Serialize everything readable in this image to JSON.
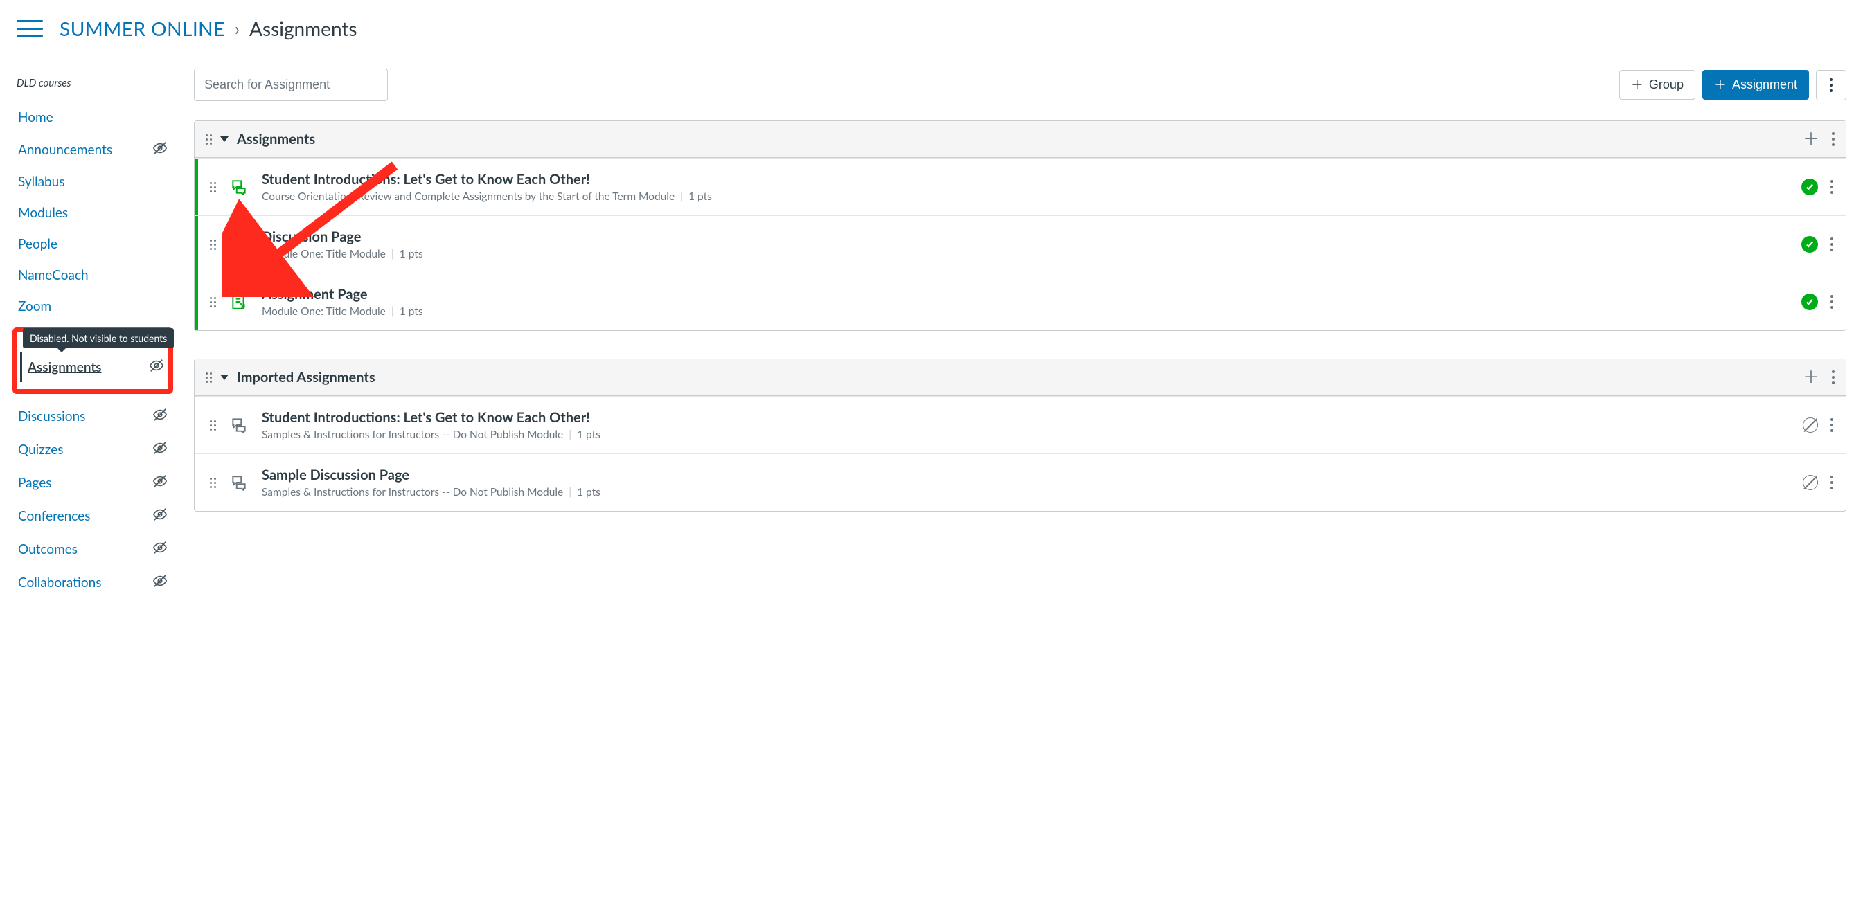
{
  "breadcrumb": {
    "course_link": "SUMMER ONLINE",
    "page": "Assignments"
  },
  "sidebar": {
    "section_title": "DLD courses",
    "items": [
      {
        "label": "Home",
        "hidden": false,
        "active": false
      },
      {
        "label": "Announcements",
        "hidden": true,
        "active": false
      },
      {
        "label": "Syllabus",
        "hidden": false,
        "active": false
      },
      {
        "label": "Modules",
        "hidden": false,
        "active": false
      },
      {
        "label": "People",
        "hidden": false,
        "active": false
      },
      {
        "label": "NameCoach",
        "hidden": false,
        "active": false
      },
      {
        "label": "Zoom",
        "hidden": false,
        "active": false
      },
      {
        "label": "Assignments",
        "hidden": true,
        "active": true
      },
      {
        "label": "Discussions",
        "hidden": true,
        "active": false
      },
      {
        "label": "Quizzes",
        "hidden": true,
        "active": false
      },
      {
        "label": "Pages",
        "hidden": true,
        "active": false
      },
      {
        "label": "Conferences",
        "hidden": true,
        "active": false
      },
      {
        "label": "Outcomes",
        "hidden": true,
        "active": false
      },
      {
        "label": "Collaborations",
        "hidden": true,
        "active": false
      }
    ],
    "tooltip": "Disabled. Not visible to students"
  },
  "toolbar": {
    "search_placeholder": "Search for Assignment",
    "group_btn": "Group",
    "assignment_btn": "Assignment"
  },
  "groups": [
    {
      "title": "Assignments",
      "items": [
        {
          "title": "Student Introductions: Let's Get to Know Each Other!",
          "module": "Course Orientation: Review and Complete Assignments by the Start of the Term Module",
          "points": "1 pts",
          "type": "discussion",
          "published": true
        },
        {
          "title": "Discussion Page",
          "module": "Module One: Title Module",
          "points": "1 pts",
          "type": "discussion",
          "published": true
        },
        {
          "title": "Assignment Page",
          "module": "Module One: Title Module",
          "points": "1 pts",
          "type": "assignment",
          "published": true
        }
      ]
    },
    {
      "title": "Imported Assignments",
      "items": [
        {
          "title": "Student Introductions: Let's Get to Know Each Other!",
          "module": "Samples & Instructions for Instructors -- Do Not Publish Module",
          "points": "1 pts",
          "type": "discussion",
          "published": false
        },
        {
          "title": "Sample Discussion Page",
          "module": "Samples & Instructions for Instructors -- Do Not Publish Module",
          "points": "1 pts",
          "type": "discussion",
          "published": false
        }
      ]
    }
  ]
}
